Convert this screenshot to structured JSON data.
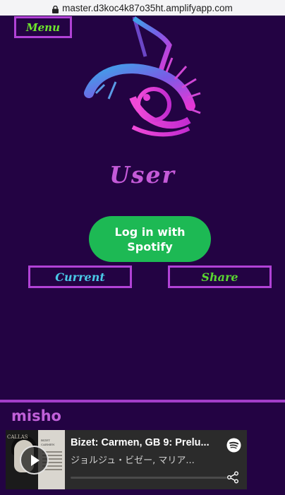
{
  "browser": {
    "url": "master.d3koc4k87o35ht.amplifyapp.com"
  },
  "nav": {
    "menu_label": "Menu"
  },
  "page": {
    "title": "User"
  },
  "login": {
    "line1": "Log in with",
    "line2": "Spotify"
  },
  "actions": {
    "current_label": "Current",
    "share_label": "Share"
  },
  "footer": {
    "username": "misho"
  },
  "player": {
    "track_title": "Bizet: Carmen, GB 9: Prelu...",
    "artist": "ジョルジュ・ビゼー, マリア...",
    "cover_text": "CALLAS",
    "cover_subtitle": "BIZET CARMEN",
    "progress": 0
  },
  "colors": {
    "background": "#230343",
    "accent_border": "#b142d6",
    "spotify_green": "#1db954",
    "title_purple": "#c45ad8",
    "menu_green": "#6ee62d",
    "current_cyan": "#49c8e6"
  },
  "icons": [
    "lock-icon",
    "music-eye-logo",
    "play-icon",
    "spotify-icon",
    "share-icon"
  ]
}
